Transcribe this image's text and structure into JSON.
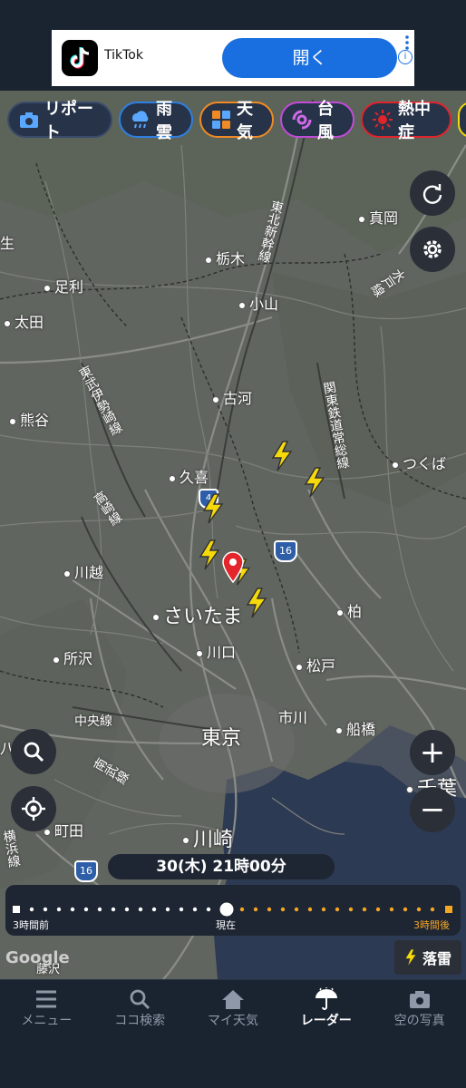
{
  "ad": {
    "app_name": "TikTok",
    "open_label": "開く",
    "info_icon": "info-icon"
  },
  "chips": [
    {
      "label": "リポート",
      "icon": "camera-icon",
      "border": "#3a4a6a"
    },
    {
      "label": "雨雲",
      "icon": "rain-cloud-icon",
      "border": "#2f7fe0"
    },
    {
      "label": "天気",
      "icon": "weather-grid-icon",
      "border": "#f08a24"
    },
    {
      "label": "台風",
      "icon": "typhoon-icon",
      "border": "#c24bd8"
    },
    {
      "label": "熱中症",
      "icon": "sun-icon",
      "border": "#e0242c"
    }
  ],
  "map": {
    "places": {
      "mooka": "真岡",
      "tochigi": "栃木",
      "oyama": "小山",
      "ashikaga": "足利",
      "ota": "太田",
      "koga": "古河",
      "kumagaya": "熊谷",
      "tsukuba": "つくば",
      "kuki": "久喜",
      "kawagoe": "川越",
      "saitama": "さいたま",
      "kashiwa": "柏",
      "tokorozawa": "所沢",
      "kawaguchi": "川口",
      "matsudo": "松戸",
      "tokyo": "東京",
      "ichikawa": "市川",
      "funabashi": "船橋",
      "chiba": "千葉",
      "machida": "町田",
      "kawasaki": "川崎",
      "yokohama": "横浜",
      "fujisawa": "藤沢",
      "hachioji": "八王子",
      "sei": "生"
    },
    "lines": {
      "tohoku": "東北新幹線",
      "tobu": "東武伊勢崎線",
      "kanto": "関東鉄道常総線",
      "mito": "水戸線",
      "takasaki": "高崎線",
      "chuo": "中央線",
      "nambu": "南武線",
      "yokohama_line": "横浜線"
    },
    "routes": {
      "r16a": "16",
      "r16b": "16",
      "r4": "4"
    },
    "google": "Google"
  },
  "controls": {
    "refresh_icon": "refresh-icon",
    "settings_icon": "gear-icon",
    "search_icon": "search-icon",
    "locate_icon": "locate-icon",
    "zoom_in": "+",
    "zoom_out": "−"
  },
  "timeline": {
    "current_time": "30(木) 21時00分",
    "past_label": "3時間前",
    "now_label": "現在",
    "future_label": "3時間後",
    "now_position": 0.5
  },
  "lightning_label": "落雷",
  "nav": [
    {
      "label": "メニュー",
      "icon": "menu-icon"
    },
    {
      "label": "ココ検索",
      "icon": "search-icon"
    },
    {
      "label": "マイ天気",
      "icon": "home-icon"
    },
    {
      "label": "レーダー",
      "icon": "umbrella-icon",
      "active": true
    },
    {
      "label": "空の写真",
      "icon": "camera-icon"
    }
  ],
  "colors": {
    "accent": "#1a6fe0",
    "future": "#f5a623",
    "lightning": "#f5d90a",
    "pin": "#e3262b"
  }
}
